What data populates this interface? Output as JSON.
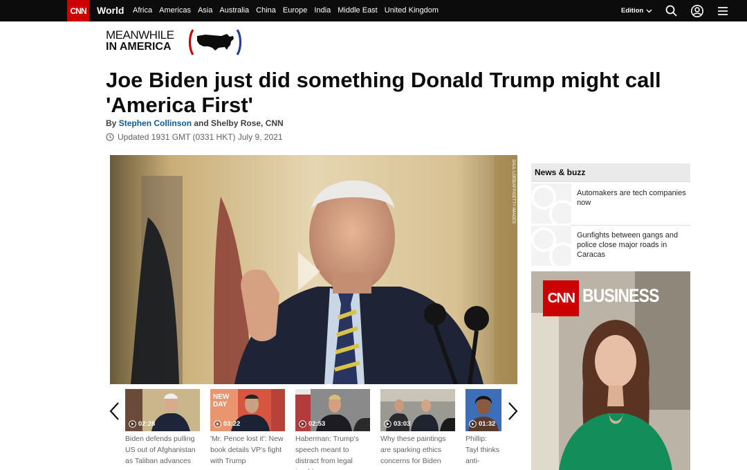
{
  "topnav": {
    "logo": "CNN",
    "section": "World",
    "links": [
      "Africa",
      "Americas",
      "Asia",
      "Australia",
      "China",
      "Europe",
      "India",
      "Middle East",
      "United Kingdom"
    ],
    "edition_label": "Edition",
    "icons": [
      "search-icon",
      "user-icon",
      "menu-icon"
    ]
  },
  "branding": {
    "line1": "MEANWHILE",
    "line2": "IN AMERICA"
  },
  "article": {
    "headline": "Joe Biden just did something Donald Trump might call 'America First'",
    "by_prefix": "By ",
    "author": "Stephen Collinson",
    "by_rest": " and Shelby Rose, CNN",
    "updated": "Updated 1931 GMT (0331 HKT) July 9, 2021"
  },
  "video_carousel": [
    {
      "duration": "02:28",
      "caption": "Biden defends pulling US out of Afghanistan as Taliban advances"
    },
    {
      "duration": "03:22",
      "caption": "'Mr. Pence lost it': New book details VP's fight with Trump"
    },
    {
      "duration": "02:53",
      "caption": "Haberman: Trump's speech meant to distract from legal trouble"
    },
    {
      "duration": "03:03",
      "caption": "Why these paintings are sparking ethics concerns for Biden"
    },
    {
      "duration": "01:32",
      "caption": "Phillip: Tayl thinks anti- comments"
    }
  ],
  "sidebar": {
    "heading": "News & buzz",
    "items": [
      {
        "text": "Automakers are tech companies now"
      },
      {
        "text": "Gunfights between gangs and police close major roads in Caracas"
      }
    ],
    "ad": {
      "logo": "CNN",
      "label": "BUSINESS"
    }
  },
  "colors": {
    "cnn_red": "#cc0000",
    "nav_bg": "#0c0c0c",
    "link_blue": "#0a5c99"
  }
}
